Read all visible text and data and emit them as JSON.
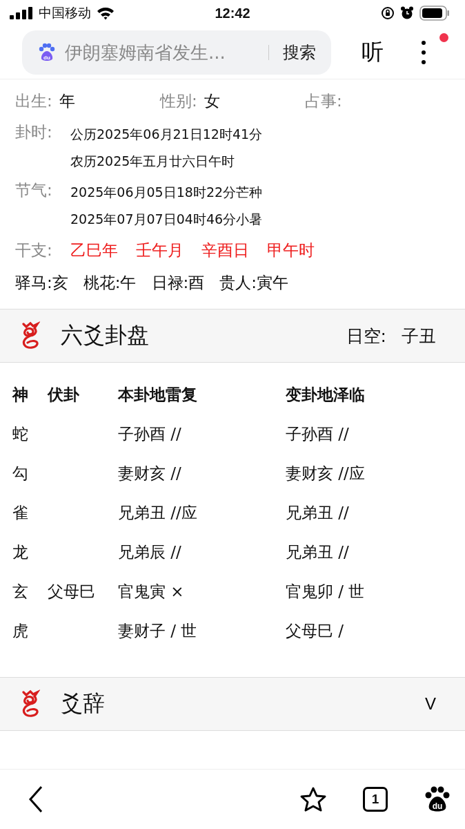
{
  "status_bar": {
    "carrier": "中国移动",
    "time": "12:42"
  },
  "search_bar": {
    "logo_text": "du",
    "query": "伊朗塞姆南省发生...",
    "search_button": "搜索",
    "listen_button": "听",
    "has_notification": true
  },
  "info": {
    "birth_label": "出生:",
    "birth_value": "年",
    "gender_label": "性别:",
    "gender_value": "女",
    "matter_label": "占事:",
    "time_label": "卦时:",
    "time_lines": [
      "公历2025年06月21日12时41分",
      "农历2025年五月廿六日午时"
    ],
    "solar_label": "节气:",
    "solar_lines": [
      "2025年06月05日18时22分芒种",
      "2025年07月07日04时46分小暑"
    ],
    "ganzhi_label": "干支:",
    "ganzhi": [
      "乙巳年",
      "壬午月",
      "辛酉日",
      "甲午时"
    ],
    "stars": [
      "驿马:亥",
      "桃花:午",
      "日禄:酉",
      "贵人:寅午"
    ]
  },
  "chart_section": {
    "title": "六爻卦盘",
    "empty_label": "日空:",
    "empty_value": "子丑"
  },
  "table": {
    "columns": [
      "神",
      "伏卦",
      "本卦地雷复",
      "变卦地泽临"
    ],
    "rows": [
      [
        "蛇",
        "",
        "子孙酉 //",
        "子孙酉 //"
      ],
      [
        "勾",
        "",
        "妻财亥 //",
        "妻财亥 //应"
      ],
      [
        "雀",
        "",
        "兄弟丑 //应",
        "兄弟丑 //"
      ],
      [
        "龙",
        "",
        "兄弟辰 //",
        "兄弟丑 //"
      ],
      [
        "玄",
        "父母巳",
        "官鬼寅 ×",
        "官鬼卯 / 世"
      ],
      [
        "虎",
        "",
        "妻财子 / 世",
        "父母巳 /"
      ]
    ]
  },
  "yao_section": {
    "title": "爻辞",
    "toggle": "V",
    "expanded": false
  },
  "bottom_bar": {
    "tab_count": "1",
    "logo_text": "du"
  }
}
